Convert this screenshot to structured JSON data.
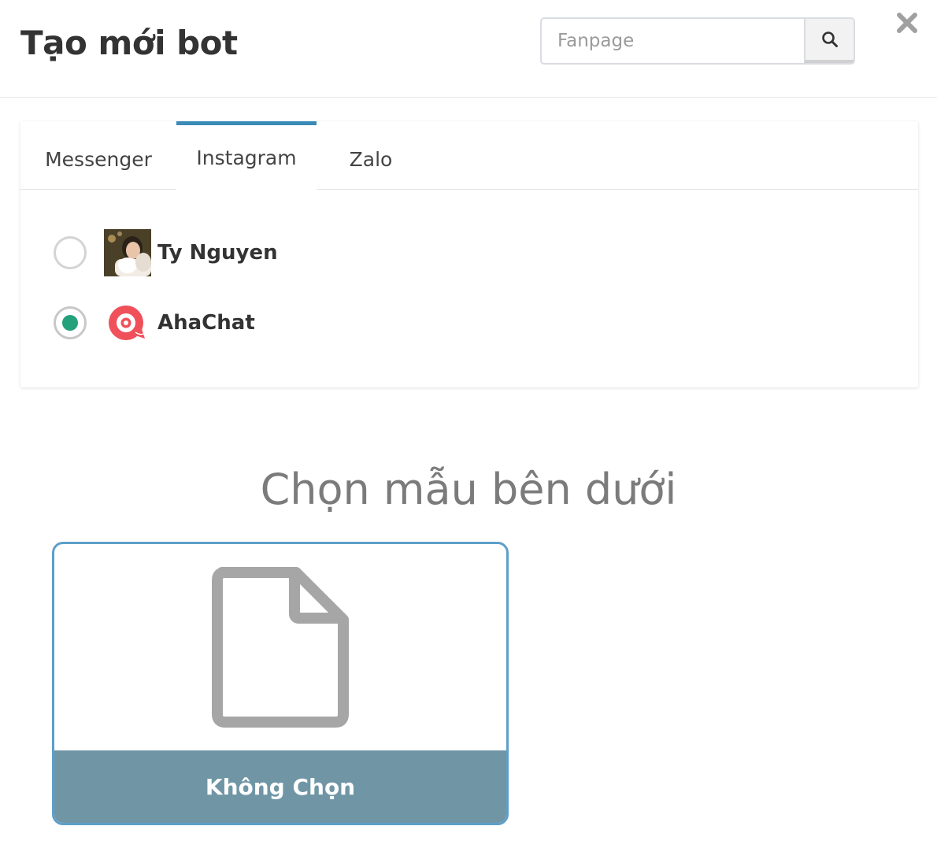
{
  "header": {
    "title": "Tạo mới bot",
    "search": {
      "placeholder": "Fanpage",
      "value": ""
    }
  },
  "tabs": [
    {
      "label": "Messenger",
      "active": false
    },
    {
      "label": "Instagram",
      "active": true
    },
    {
      "label": "Zalo",
      "active": false
    }
  ],
  "accounts": [
    {
      "name": "Ty Nguyen",
      "selected": false,
      "avatar_icon": "user-photo-avatar"
    },
    {
      "name": "AhaChat",
      "selected": true,
      "avatar_icon": "ahachat-logo-icon"
    }
  ],
  "templates": {
    "heading": "Chọn mẫu bên dưới",
    "items": [
      {
        "label": "Không Chọn",
        "icon": "blank-document-icon"
      }
    ]
  },
  "colors": {
    "accent": "#3a8bb7",
    "radio_selected": "#23a07c",
    "card_border": "#5d9fc9",
    "card_footer": "#7096a6",
    "ahachat_brand": "#f0505a"
  }
}
